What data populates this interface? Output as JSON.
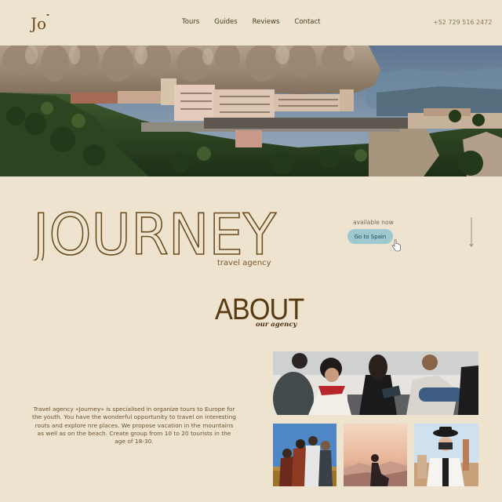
{
  "header": {
    "logo": "Jo",
    "nav": [
      "Tours",
      "Guides",
      "Reviews",
      "Contact"
    ],
    "phone": "+52 729 516 2472"
  },
  "hero": {
    "title": "JOURNEY",
    "tagline": "travel agency",
    "availability": "available now",
    "cta_label": "Go to Spain"
  },
  "about": {
    "title": "ABOUT",
    "subtitle": "our agency",
    "text": "Travel agency «Journey» is specialised in organize tours to Europe for the youth. You have the wonderful opportunity to travel on interesting routs and explore nre places. We propose vacation in the mountains as well as on the beach. Create group from 10 to 20 tourists in the age of 18-30."
  },
  "colors": {
    "background": "#ede3cf",
    "brand_brown": "#6b4a1e",
    "cta_blue": "#9ec8cf"
  }
}
